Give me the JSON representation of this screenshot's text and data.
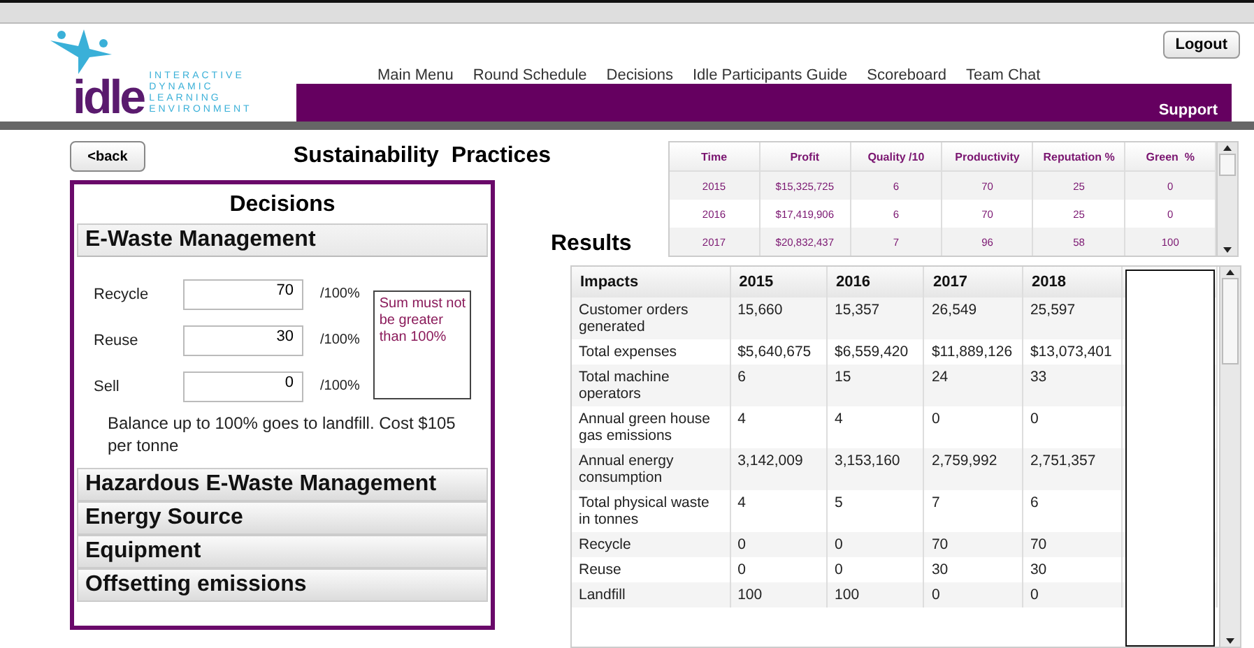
{
  "logo": {
    "wordmark": "idle",
    "tagline": [
      "INTERACTIVE",
      "DYNAMIC",
      "LEARNING",
      "ENVIRONMENT"
    ]
  },
  "nav": [
    "Main Menu",
    "Round Schedule",
    "Decisions",
    "Idle Participants Guide",
    "Scoreboard",
    "Team Chat"
  ],
  "support_link": "Support",
  "logout_button": "Logout",
  "back_button": "<back",
  "page_title": "Sustainability  Practices",
  "decisions": {
    "title": "Decisions",
    "sections": [
      {
        "title": "E-Waste Management",
        "expanded": true,
        "fields": [
          {
            "label": "Recycle",
            "value": "70",
            "suffix": "/100%"
          },
          {
            "label": "Reuse",
            "value": "30",
            "suffix": "/100%"
          },
          {
            "label": "Sell",
            "value": "0",
            "suffix": "/100%"
          }
        ],
        "warning": "Sum must not be greater than 100%",
        "note": "Balance up to 100% goes to landfill. Cost $105 per tonne"
      },
      {
        "title": "Hazardous E-Waste Management",
        "expanded": false
      },
      {
        "title": "Energy Source",
        "expanded": false
      },
      {
        "title": "Equipment",
        "expanded": false
      },
      {
        "title": "Offsetting emissions",
        "expanded": false
      }
    ]
  },
  "summary_table": {
    "columns": [
      "Time",
      "Profit",
      "Quality /10",
      "Productivity",
      "Reputation %",
      "Green  %"
    ],
    "rows": [
      [
        "2015",
        "$15,325,725",
        "6",
        "70",
        "25",
        "0"
      ],
      [
        "2016",
        "$17,419,906",
        "6",
        "70",
        "25",
        "0"
      ],
      [
        "2017",
        "$20,832,437",
        "7",
        "96",
        "58",
        "100"
      ]
    ]
  },
  "results_title": "Results",
  "impacts_table": {
    "columns": [
      "Impacts",
      "2015",
      "2016",
      "2017",
      "2018"
    ],
    "rows": [
      [
        "Customer orders generated",
        "15,660",
        "15,357",
        "26,549",
        "25,597"
      ],
      [
        "Total expenses",
        "$5,640,675",
        "$6,559,420",
        "$11,889,126",
        "$13,073,401"
      ],
      [
        "Total machine operators",
        "6",
        "15",
        "24",
        "33"
      ],
      [
        "Annual green house gas emissions",
        "4",
        "4",
        "0",
        "0"
      ],
      [
        "Annual energy consumption",
        "3,142,009",
        "3,153,160",
        "2,759,992",
        "2,751,357"
      ],
      [
        "Total physical waste in tonnes",
        "4",
        "5",
        "7",
        "6"
      ],
      [
        "Recycle",
        "0",
        "0",
        "70",
        "70"
      ],
      [
        "Reuse",
        "0",
        "0",
        "30",
        "30"
      ],
      [
        "Landfill",
        "100",
        "100",
        "0",
        "0"
      ]
    ]
  }
}
